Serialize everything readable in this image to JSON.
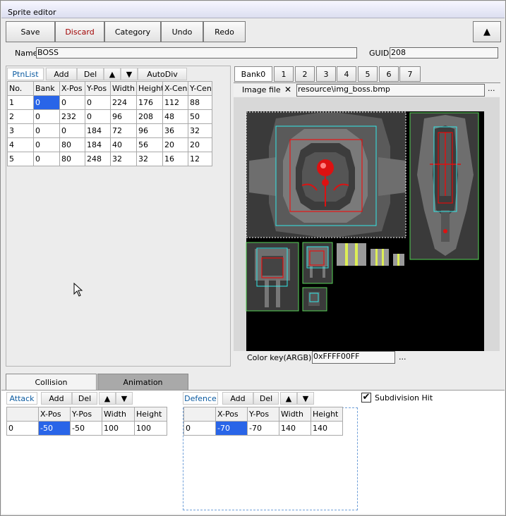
{
  "window": {
    "title": "Sprite editor"
  },
  "toolbar": {
    "save": "Save",
    "discard": "Discard",
    "category": "Category",
    "undo": "Undo",
    "redo": "Redo",
    "collapse": "▲"
  },
  "info": {
    "name_label": "Name",
    "name_value": "BOSS",
    "guid_label": "GUID",
    "guid_value": "208"
  },
  "ptnlist": {
    "tab": "PtnList",
    "add": "Add",
    "del": "Del",
    "up": "▲",
    "down": "▼",
    "autodiv": "AutoDiv",
    "headers": [
      "No.",
      "Bank",
      "X-Pos",
      "Y-Pos",
      "Width",
      "Height",
      "X-Cen",
      "Y-Cen"
    ],
    "rows": [
      [
        "1",
        "0",
        "0",
        "0",
        "224",
        "176",
        "112",
        "88"
      ],
      [
        "2",
        "0",
        "232",
        "0",
        "96",
        "208",
        "48",
        "50"
      ],
      [
        "3",
        "0",
        "0",
        "184",
        "72",
        "96",
        "36",
        "32"
      ],
      [
        "4",
        "0",
        "80",
        "184",
        "40",
        "56",
        "20",
        "20"
      ],
      [
        "5",
        "0",
        "80",
        "248",
        "32",
        "32",
        "16",
        "12"
      ]
    ]
  },
  "banks": [
    "Bank0",
    "1",
    "2",
    "3",
    "4",
    "5",
    "6",
    "7"
  ],
  "image": {
    "label": "Image file",
    "close": "✕",
    "path": "resource\\img_boss.bmp",
    "browse": "...",
    "colorkey_label": "Color key(ARGB)",
    "colorkey_value": "0xFFFF00FF",
    "colorkey_browse": "..."
  },
  "bottom": {
    "collision_tab": "Collision",
    "animation_tab": "Animation",
    "subdivision_label": "Subdivision Hit",
    "subdivision_checked": true
  },
  "attack": {
    "title": "Attack",
    "add": "Add",
    "del": "Del",
    "up": "▲",
    "down": "▼",
    "headers": [
      "",
      "X-Pos",
      "Y-Pos",
      "Width",
      "Height"
    ],
    "rows": [
      [
        "0",
        "-50",
        "-50",
        "100",
        "100"
      ]
    ]
  },
  "defence": {
    "title": "Defence",
    "add": "Add",
    "del": "Del",
    "up": "▲",
    "down": "▼",
    "headers": [
      "",
      "X-Pos",
      "Y-Pos",
      "Width",
      "Height"
    ],
    "rows": [
      [
        "0",
        "-70",
        "-70",
        "140",
        "140"
      ]
    ]
  },
  "colors": {
    "selection": "#2965e8",
    "box_outline": "#31e8e8",
    "sprite_outline": "#56d456",
    "hit_red": "#ff0000"
  }
}
